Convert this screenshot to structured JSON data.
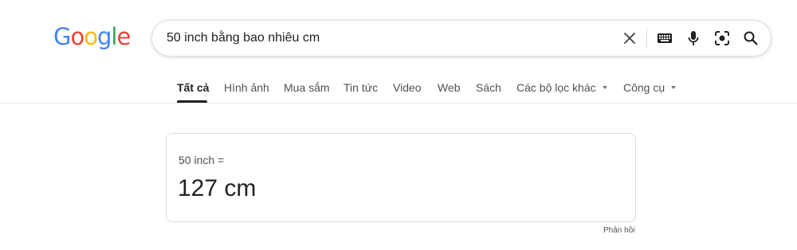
{
  "logo": {
    "letters": [
      "G",
      "o",
      "o",
      "g",
      "l",
      "e"
    ],
    "colors": [
      "#4285F4",
      "#EA4335",
      "#FBBC05",
      "#4285F4",
      "#34A853",
      "#EA4335"
    ]
  },
  "search": {
    "query": "50 inch bằng bao nhiêu cm",
    "icons": [
      "clear-icon",
      "keyboard-icon",
      "microphone-icon",
      "camera-lens-icon",
      "search-icon"
    ]
  },
  "tabs": [
    {
      "label": "Tất cả",
      "active": true
    },
    {
      "label": "Hình ảnh"
    },
    {
      "label": "Mua sắm"
    },
    {
      "label": "Tin tức"
    },
    {
      "label": "Video"
    },
    {
      "label": "Web"
    },
    {
      "label": "Sách"
    },
    {
      "label": "Các bộ lọc khác",
      "dropdown": true
    },
    {
      "label": "Công cụ",
      "dropdown": true
    }
  ],
  "converter": {
    "input_text": "50 inch =",
    "result_text": "127 cm"
  },
  "feedback": "Phản hồi"
}
